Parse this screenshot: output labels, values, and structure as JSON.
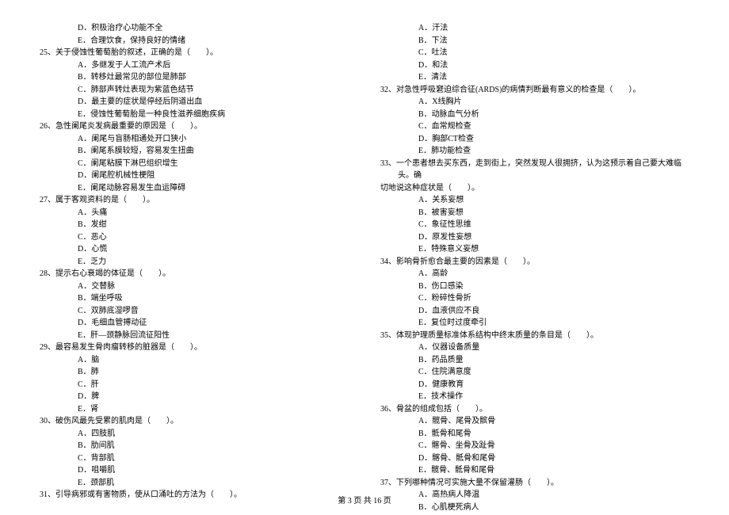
{
  "footer": "第 3 页 共 16 页",
  "left": [
    {
      "cls": "option",
      "text": "D．积极治疗心功能不全"
    },
    {
      "cls": "option",
      "text": "E．合理饮食，保持良好的情绪"
    },
    {
      "cls": "question",
      "text": "25、关于侵蚀性葡萄胎的叙述，正确的是（　　）。"
    },
    {
      "cls": "option",
      "text": "A．多继发于人工流产术后"
    },
    {
      "cls": "option",
      "text": "B．转移灶最常见的部位是肺部"
    },
    {
      "cls": "option",
      "text": "C．肺部声转灶表现为紫蓝色结节"
    },
    {
      "cls": "option",
      "text": "D．最主要的症状是停经后阴道出血"
    },
    {
      "cls": "option",
      "text": "E．侵蚀性葡萄胎是一种良性滋养细胞疾病"
    },
    {
      "cls": "question",
      "text": "26、急性阑尾炎发病最重要的原因是（　　）。"
    },
    {
      "cls": "option",
      "text": "A．阑尾与盲肠相通处开口狭小"
    },
    {
      "cls": "option",
      "text": "B．阑尾系膜较短，容易发生扭曲"
    },
    {
      "cls": "option",
      "text": "C．阑尾粘膜下淋巴组织增生"
    },
    {
      "cls": "option",
      "text": "D．阑尾腔机械性梗阻"
    },
    {
      "cls": "option",
      "text": "E．阑尾动脉容易发生血运障碍"
    },
    {
      "cls": "question",
      "text": "27、属于客观资料的是（　　）。"
    },
    {
      "cls": "option",
      "text": "A．头痛"
    },
    {
      "cls": "option",
      "text": "B．发绀"
    },
    {
      "cls": "option",
      "text": "C．恶心"
    },
    {
      "cls": "option",
      "text": "D．心慌"
    },
    {
      "cls": "option",
      "text": "E．乏力"
    },
    {
      "cls": "question",
      "text": "28、提示右心衰竭的体征是（　　）。"
    },
    {
      "cls": "option",
      "text": "A．交替脉"
    },
    {
      "cls": "option",
      "text": "B．端坐呼吸"
    },
    {
      "cls": "option",
      "text": "C．双肺底湿啰音"
    },
    {
      "cls": "option",
      "text": "D．毛细血管搏动征"
    },
    {
      "cls": "option",
      "text": "E．肝—颈静脉回流征阳性"
    },
    {
      "cls": "question",
      "text": "29、最容易发生骨肉瘤转移的脏器是（　　）。"
    },
    {
      "cls": "option",
      "text": "A．脑"
    },
    {
      "cls": "option",
      "text": "B．肺"
    },
    {
      "cls": "option",
      "text": "C．肝"
    },
    {
      "cls": "option",
      "text": "D．脾"
    },
    {
      "cls": "option",
      "text": "E．肾"
    },
    {
      "cls": "question",
      "text": "30、破伤风最先受累的肌肉是（　　）。"
    },
    {
      "cls": "option",
      "text": "A．四肢肌"
    },
    {
      "cls": "option",
      "text": "B．肋间肌"
    },
    {
      "cls": "option",
      "text": "C．背部肌"
    },
    {
      "cls": "option",
      "text": "D．咀嚼肌"
    },
    {
      "cls": "option",
      "text": "E．颈部肌"
    },
    {
      "cls": "question",
      "text": "31、引导病邪或有害物质，使从口涌吐的方法为（　　）。"
    }
  ],
  "right": [
    {
      "cls": "option",
      "text": "A．汗法"
    },
    {
      "cls": "option",
      "text": "B．下法"
    },
    {
      "cls": "option",
      "text": "C．吐法"
    },
    {
      "cls": "option",
      "text": "D．和法"
    },
    {
      "cls": "option",
      "text": "E．清法"
    },
    {
      "cls": "question",
      "text": "32、对急性呼吸窘迫综合征(ARDS)的病情判断最有意义的检查是（　　）。"
    },
    {
      "cls": "option",
      "text": "A．X线胸片"
    },
    {
      "cls": "option",
      "text": "B．动脉血气分析"
    },
    {
      "cls": "option",
      "text": "C．血常规检查"
    },
    {
      "cls": "option",
      "text": "D．胸部CT检查"
    },
    {
      "cls": "option",
      "text": "E．肺功能检查"
    },
    {
      "cls": "question",
      "text": "33、一个患者想去买东西，走到街上，突然发现人很拥挤，认为这预示着自己要大难临头。确"
    },
    {
      "cls": "question-cont",
      "text": "切地说这种症状是（　　）。"
    },
    {
      "cls": "option",
      "text": "A．关系妄想"
    },
    {
      "cls": "option",
      "text": "B．被害妄想"
    },
    {
      "cls": "option",
      "text": "C．象征性思维"
    },
    {
      "cls": "option",
      "text": "D．原发性妄想"
    },
    {
      "cls": "option",
      "text": "E．特殊意义妄想"
    },
    {
      "cls": "question",
      "text": "34、影响骨折愈合最主要的因素是（　　）。"
    },
    {
      "cls": "option",
      "text": "A．高龄"
    },
    {
      "cls": "option",
      "text": "B．伤口感染"
    },
    {
      "cls": "option",
      "text": "C．粉碎性骨折"
    },
    {
      "cls": "option",
      "text": "D．血液供应不良"
    },
    {
      "cls": "option",
      "text": "E．复位时过度牵引"
    },
    {
      "cls": "question",
      "text": "35、体现护理质量标准体系结构中终末质量的条目是（　　）。"
    },
    {
      "cls": "option",
      "text": "A．仪器设备质量"
    },
    {
      "cls": "option",
      "text": "B．药品质量"
    },
    {
      "cls": "option",
      "text": "C．住院满意度"
    },
    {
      "cls": "option",
      "text": "D．健康教育"
    },
    {
      "cls": "option",
      "text": "E．技术操作"
    },
    {
      "cls": "question",
      "text": "36、骨盆的组成包括（　　）。"
    },
    {
      "cls": "option",
      "text": "A．髋骨、尾骨及髌骨"
    },
    {
      "cls": "option",
      "text": "B．骶骨和尾骨"
    },
    {
      "cls": "option",
      "text": "C．髂骨、坐骨及趾骨"
    },
    {
      "cls": "option",
      "text": "D．髂骨、骶骨和尾骨"
    },
    {
      "cls": "option",
      "text": "E．髋骨、骶骨和尾骨"
    },
    {
      "cls": "question",
      "text": "37、下列哪种情况可实施大量不保留灌肠（　　）。"
    },
    {
      "cls": "option",
      "text": "A．高热病人降温"
    },
    {
      "cls": "option",
      "text": "B．心肌梗死病人"
    }
  ]
}
